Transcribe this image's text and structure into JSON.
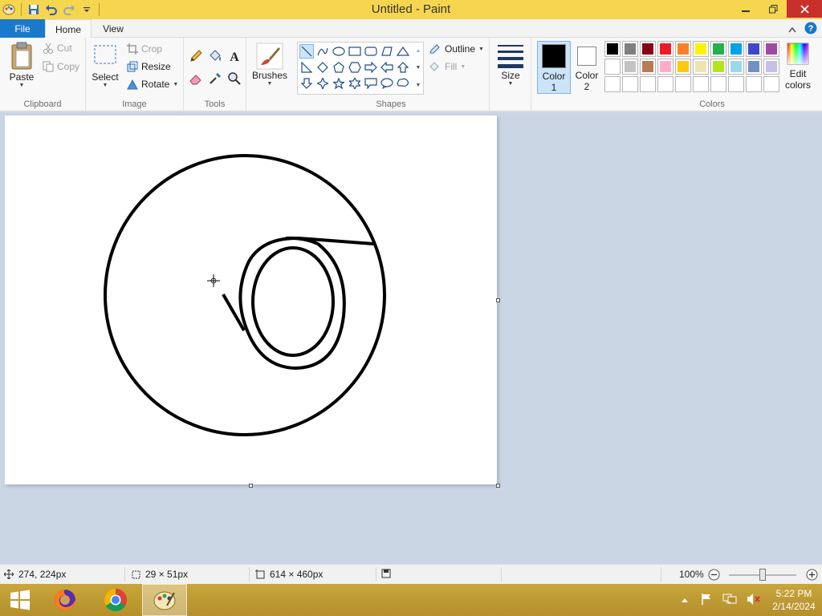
{
  "window": {
    "title": "Untitled - Paint",
    "qat_icons": [
      "paint-app-icon",
      "save-icon",
      "undo-icon",
      "redo-icon",
      "customize-qat-icon"
    ]
  },
  "tabs": {
    "file": "File",
    "home": "Home",
    "view": "View"
  },
  "ribbon": {
    "clipboard": {
      "paste": "Paste",
      "cut": "Cut",
      "copy": "Copy",
      "label": "Clipboard"
    },
    "image": {
      "select": "Select",
      "crop": "Crop",
      "resize": "Resize",
      "rotate": "Rotate",
      "label": "Image"
    },
    "tools": {
      "label": "Tools",
      "items": [
        "pencil-icon",
        "fill-bucket-icon",
        "text-icon",
        "eraser-icon",
        "color-picker-icon",
        "magnifier-icon"
      ]
    },
    "brushes": {
      "label": "Brushes"
    },
    "shapes": {
      "outline": "Outline",
      "fill": "Fill",
      "label": "Shapes",
      "selected": "line"
    },
    "size": {
      "label": "Size"
    },
    "color1": {
      "label_line1": "Color",
      "label_line2": "1",
      "value": "#000000"
    },
    "color2": {
      "label_line1": "Color",
      "label_line2": "2",
      "value": "#ffffff"
    },
    "colors": {
      "label": "Colors",
      "edit_line1": "Edit",
      "edit_line2": "colors",
      "row1": [
        "#000000",
        "#7f7f7f",
        "#880015",
        "#ed1c24",
        "#ff7f27",
        "#fff200",
        "#22b14c",
        "#00a2e8",
        "#3f48cc",
        "#a349a4"
      ],
      "row2": [
        "#ffffff",
        "#c3c3c3",
        "#b97a57",
        "#ffaec9",
        "#ffc90e",
        "#efe4b0",
        "#b5e61d",
        "#99d9ea",
        "#7092be",
        "#c8bfe7"
      ],
      "row3": [
        "#ffffff",
        "#ffffff",
        "#ffffff",
        "#ffffff",
        "#ffffff",
        "#ffffff",
        "#ffffff",
        "#ffffff",
        "#ffffff",
        "#ffffff"
      ]
    }
  },
  "status": {
    "cursor_pos": "274, 224px",
    "selection_size": "29 × 51px",
    "canvas_size": "614 × 460px",
    "zoom": "100%"
  },
  "taskbar": {
    "apps": [
      "windows-start-icon",
      "firefox-icon",
      "chrome-icon",
      "paint-icon"
    ],
    "time": "5:22 PM",
    "date": "2/14/2024"
  }
}
